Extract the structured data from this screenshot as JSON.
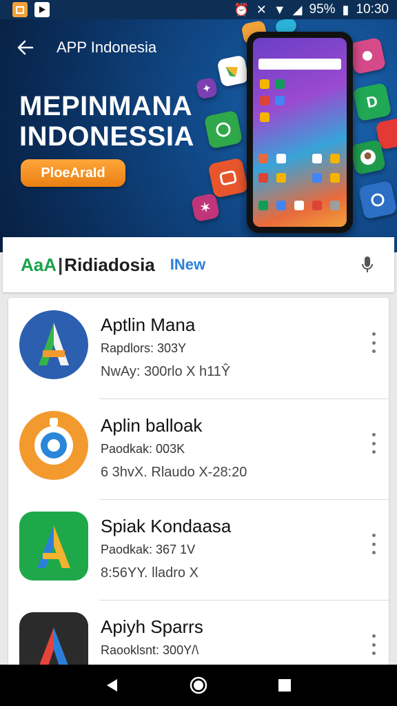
{
  "status_bar": {
    "battery": "95%",
    "time": "10:30"
  },
  "hero": {
    "title": "APP Indonesia",
    "headline_line1": "MEPINMANA",
    "headline_line2": "INDONESSIA",
    "cta_label": "PloeAraId"
  },
  "search": {
    "brand_aa": "AaA",
    "brand_sep": "|",
    "brand_rest": "Ridiadosia",
    "tag": "INew"
  },
  "apps": [
    {
      "name": "Aptlin Mana",
      "sub": "Rapdlors: 303Y",
      "meta": "NwAy:  300rlo  X  h11Ŷ",
      "icon": "letter-a-blue-icon"
    },
    {
      "name": "Aplin balloak",
      "sub": "Paodkak: 003K",
      "meta": "6 3hvX.  Rlaudo  X-28:20",
      "icon": "camera-orange-icon"
    },
    {
      "name": "Spiak Kondaasa",
      "sub": "Paodkak: 367 1V",
      "meta": "8:56YY.  lladro  X",
      "icon": "letter-a-green-icon"
    },
    {
      "name": "Apiyh Sparrs",
      "sub": "Raooklsnt: 300Y/\\",
      "meta": "",
      "icon": "letter-a-dark-icon"
    }
  ],
  "colors": {
    "hero_bg": "#0a2e5c",
    "cta": "#f08a1c",
    "accent_blue": "#2a7fd8",
    "brand_green": "#1aa34a"
  }
}
